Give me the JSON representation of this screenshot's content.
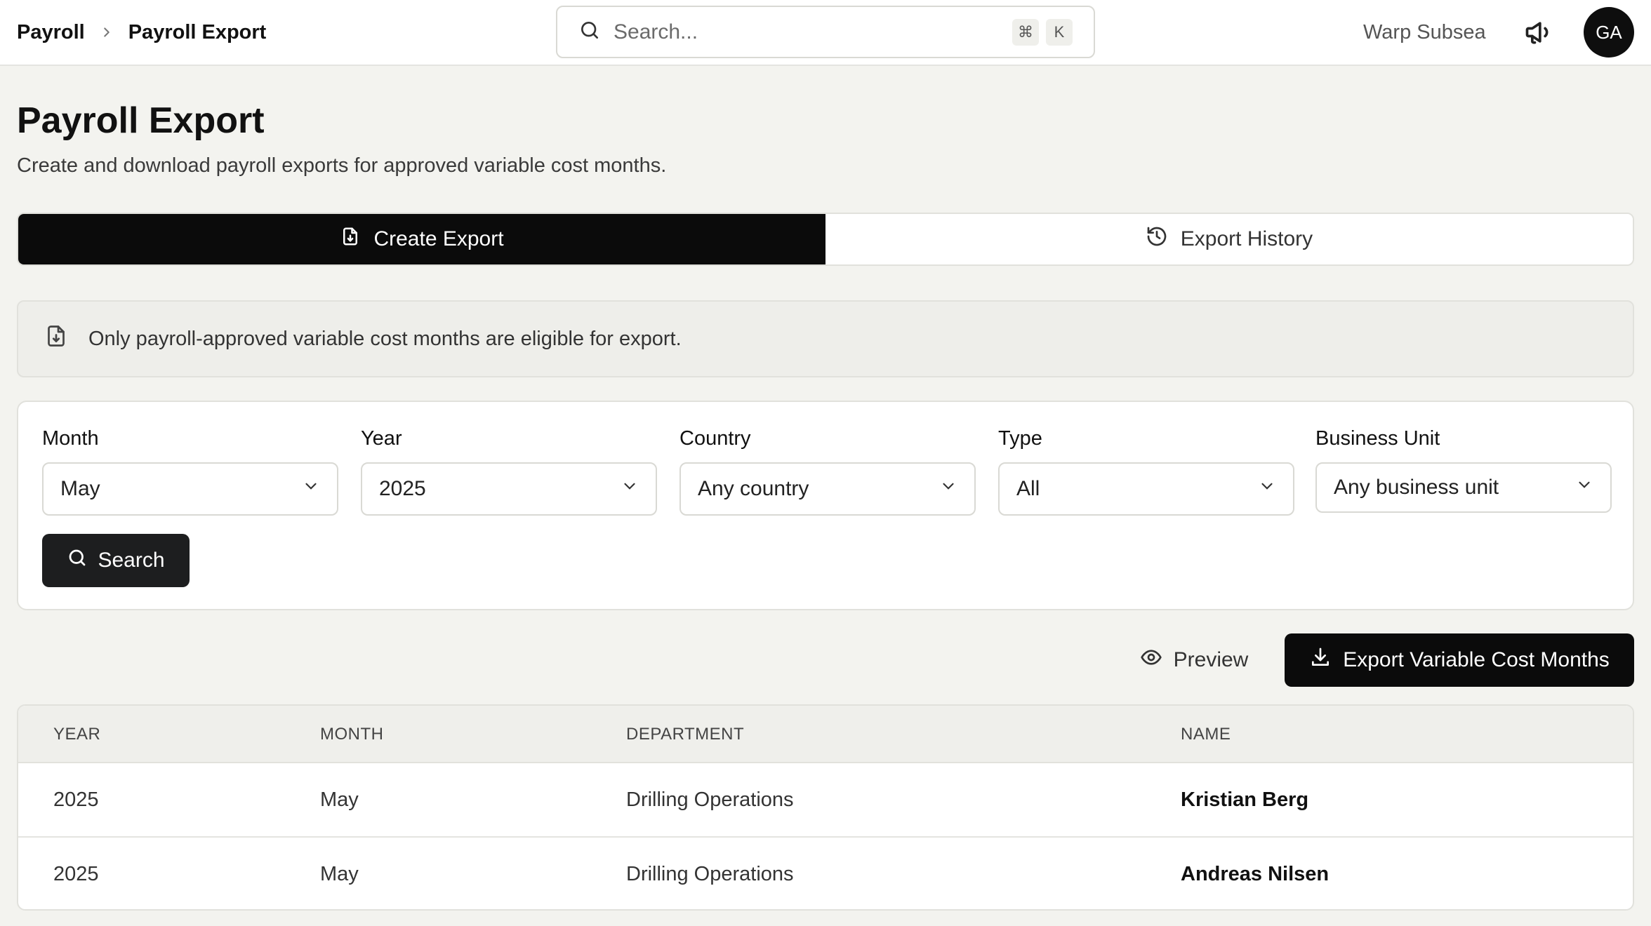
{
  "breadcrumb": {
    "parent": "Payroll",
    "current": "Payroll Export"
  },
  "search": {
    "placeholder": "Search...",
    "shortcut_mod": "⌘",
    "shortcut_key": "K"
  },
  "header": {
    "org": "Warp Subsea",
    "avatar_initials": "GA"
  },
  "page": {
    "title": "Payroll Export",
    "subtitle": "Create and download payroll exports for approved variable cost months."
  },
  "tabs": [
    {
      "label": "Create Export",
      "active": true
    },
    {
      "label": "Export History",
      "active": false
    }
  ],
  "notice": "Only payroll-approved variable cost months are eligible for export.",
  "filters": {
    "month": {
      "label": "Month",
      "value": "May"
    },
    "year": {
      "label": "Year",
      "value": "2025"
    },
    "country": {
      "label": "Country",
      "value": "Any country"
    },
    "type": {
      "label": "Type",
      "value": "All"
    },
    "business_unit": {
      "label": "Business Unit",
      "value": "Any business unit"
    },
    "search_label": "Search"
  },
  "actions": {
    "preview": "Preview",
    "export": "Export Variable Cost Months"
  },
  "table": {
    "headers": [
      "YEAR",
      "MONTH",
      "DEPARTMENT",
      "NAME"
    ],
    "rows": [
      [
        "2025",
        "May",
        "Drilling Operations",
        "Kristian Berg"
      ],
      [
        "2025",
        "May",
        "Drilling Operations",
        "Andreas Nilsen"
      ]
    ]
  },
  "colors": {
    "accent": "#0b0b0b",
    "background": "#f3f3ef"
  }
}
